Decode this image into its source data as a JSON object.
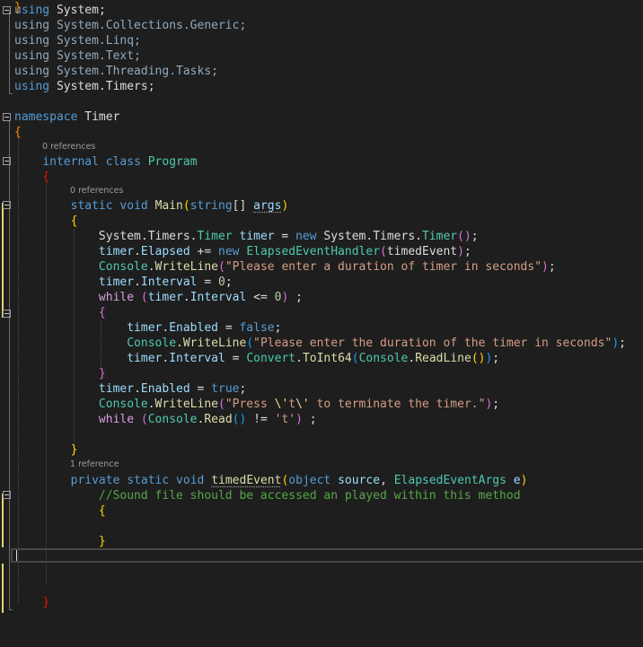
{
  "editor": {
    "codelens": {
      "program_refs": "0 references",
      "main_refs": "0 references",
      "timed_event_refs": "1 reference"
    },
    "lines": [
      {
        "id": "using-system",
        "tokens": [
          [
            "kw",
            "using"
          ],
          [
            "pl",
            " "
          ],
          [
            "pl",
            "System"
          ],
          [
            "pl",
            ";"
          ]
        ]
      },
      {
        "id": "using-collections",
        "tokens": [
          [
            "kw faded",
            "using"
          ],
          [
            "pl faded",
            " System.Collections.Generic;"
          ]
        ]
      },
      {
        "id": "using-linq",
        "tokens": [
          [
            "kw faded",
            "using"
          ],
          [
            "pl faded",
            " System.Linq;"
          ]
        ]
      },
      {
        "id": "using-text",
        "tokens": [
          [
            "kw faded",
            "using"
          ],
          [
            "pl faded",
            " System.Text;"
          ]
        ]
      },
      {
        "id": "using-tasks",
        "tokens": [
          [
            "kw faded",
            "using"
          ],
          [
            "pl faded",
            " System.Threading.Tasks;"
          ]
        ]
      },
      {
        "id": "using-timers",
        "tokens": [
          [
            "kw",
            "using"
          ],
          [
            "pl",
            " System.Timers;"
          ]
        ]
      },
      {
        "id": "blank-1",
        "tokens": []
      },
      {
        "id": "namespace-decl",
        "tokens": [
          [
            "kw",
            "namespace"
          ],
          [
            "pl",
            " Timer"
          ]
        ]
      },
      {
        "id": "ns-open",
        "tokens": [
          [
            "bo",
            "{"
          ]
        ]
      },
      {
        "id": "class-decl",
        "tokens": [
          [
            "pl",
            "    "
          ],
          [
            "kw",
            "internal"
          ],
          [
            "pl",
            " "
          ],
          [
            "kw",
            "class"
          ],
          [
            "pl",
            " "
          ],
          [
            "ty",
            "Program"
          ]
        ]
      },
      {
        "id": "class-open",
        "tokens": [
          [
            "pl",
            "    "
          ],
          [
            "br",
            "{"
          ]
        ]
      },
      {
        "id": "main-decl",
        "tokens": [
          [
            "pl",
            "        "
          ],
          [
            "kw",
            "static"
          ],
          [
            "pl",
            " "
          ],
          [
            "kw",
            "void"
          ],
          [
            "pl",
            " "
          ],
          [
            "fn",
            "Main"
          ],
          [
            "b1",
            "("
          ],
          [
            "kw",
            "string"
          ],
          [
            "pl",
            "[] "
          ],
          [
            "vr sq",
            "args"
          ],
          [
            "b1",
            ")"
          ]
        ]
      },
      {
        "id": "main-open",
        "tokens": [
          [
            "pl",
            "        "
          ],
          [
            "b1",
            "{"
          ]
        ]
      },
      {
        "id": "new-timer",
        "tokens": [
          [
            "pl",
            "            System.Timers."
          ],
          [
            "ty",
            "Timer"
          ],
          [
            "pl",
            " "
          ],
          [
            "vr",
            "timer"
          ],
          [
            "pl",
            " = "
          ],
          [
            "kw",
            "new"
          ],
          [
            "pl",
            " System.Timers."
          ],
          [
            "ty",
            "Timer"
          ],
          [
            "b2",
            "()"
          ],
          [
            "pl",
            ";"
          ]
        ]
      },
      {
        "id": "elapsed-handler",
        "tokens": [
          [
            "pl",
            "            "
          ],
          [
            "vr",
            "timer"
          ],
          [
            "pl",
            "."
          ],
          [
            "vr",
            "Elapsed"
          ],
          [
            "pl",
            " += "
          ],
          [
            "kw",
            "new"
          ],
          [
            "pl",
            " "
          ],
          [
            "ty",
            "ElapsedEventHandler"
          ],
          [
            "b2",
            "("
          ],
          [
            "pl",
            "timedEvent"
          ],
          [
            "b2",
            ")"
          ],
          [
            "pl",
            ";"
          ]
        ]
      },
      {
        "id": "prompt-1",
        "tokens": [
          [
            "pl",
            "            "
          ],
          [
            "ty",
            "Console"
          ],
          [
            "pl",
            "."
          ],
          [
            "fn",
            "WriteLine"
          ],
          [
            "b2",
            "("
          ],
          [
            "st",
            "\"Please enter a duration of timer in seconds\""
          ],
          [
            "b2",
            ")"
          ],
          [
            "pl",
            ";"
          ]
        ]
      },
      {
        "id": "interval-zero",
        "tokens": [
          [
            "pl",
            "            "
          ],
          [
            "vr",
            "timer"
          ],
          [
            "pl",
            "."
          ],
          [
            "vr",
            "Interval"
          ],
          [
            "pl",
            " = "
          ],
          [
            "nu",
            "0"
          ],
          [
            "pl",
            ";"
          ]
        ]
      },
      {
        "id": "while-interval",
        "tokens": [
          [
            "pl",
            "            "
          ],
          [
            "ctl",
            "while"
          ],
          [
            "pl",
            " "
          ],
          [
            "b2",
            "("
          ],
          [
            "vr",
            "timer"
          ],
          [
            "pl",
            "."
          ],
          [
            "vr",
            "Interval"
          ],
          [
            "pl",
            " <= "
          ],
          [
            "nu",
            "0"
          ],
          [
            "b2",
            ")"
          ],
          [
            "pl",
            " ;"
          ]
        ]
      },
      {
        "id": "while-open",
        "tokens": [
          [
            "pl",
            "            "
          ],
          [
            "b2",
            "{"
          ]
        ]
      },
      {
        "id": "enabled-false",
        "tokens": [
          [
            "pl",
            "                "
          ],
          [
            "vr",
            "timer"
          ],
          [
            "pl",
            "."
          ],
          [
            "vr",
            "Enabled"
          ],
          [
            "pl",
            " = "
          ],
          [
            "kw",
            "false"
          ],
          [
            "pl",
            ";"
          ]
        ]
      },
      {
        "id": "prompt-2",
        "tokens": [
          [
            "pl",
            "                "
          ],
          [
            "ty",
            "Console"
          ],
          [
            "pl",
            "."
          ],
          [
            "fn",
            "WriteLine"
          ],
          [
            "b3",
            "("
          ],
          [
            "st",
            "\"Please enter the duration of the timer in seconds\""
          ],
          [
            "b3",
            ")"
          ],
          [
            "pl",
            ";"
          ]
        ]
      },
      {
        "id": "interval-read",
        "tokens": [
          [
            "pl",
            "                "
          ],
          [
            "vr",
            "timer"
          ],
          [
            "pl",
            "."
          ],
          [
            "vr",
            "Interval"
          ],
          [
            "pl",
            " = "
          ],
          [
            "ty",
            "Convert"
          ],
          [
            "pl",
            "."
          ],
          [
            "fn",
            "ToInt64"
          ],
          [
            "b3",
            "("
          ],
          [
            "ty",
            "Console"
          ],
          [
            "pl",
            "."
          ],
          [
            "fn",
            "ReadLine"
          ],
          [
            "b1",
            "()"
          ],
          [
            "b3",
            ")"
          ],
          [
            "pl",
            ";"
          ]
        ]
      },
      {
        "id": "while-close",
        "tokens": [
          [
            "pl",
            "            "
          ],
          [
            "b2",
            "}"
          ]
        ]
      },
      {
        "id": "enabled-true",
        "tokens": [
          [
            "pl",
            "            "
          ],
          [
            "vr",
            "timer"
          ],
          [
            "pl",
            "."
          ],
          [
            "vr",
            "Enabled"
          ],
          [
            "pl",
            " = "
          ],
          [
            "kw",
            "true"
          ],
          [
            "pl",
            ";"
          ]
        ]
      },
      {
        "id": "prompt-3",
        "tokens": [
          [
            "pl",
            "            "
          ],
          [
            "ty",
            "Console"
          ],
          [
            "pl",
            "."
          ],
          [
            "fn",
            "WriteLine"
          ],
          [
            "b2",
            "("
          ],
          [
            "st",
            "\"Press "
          ],
          [
            "es",
            "\\'"
          ],
          [
            "st",
            "t"
          ],
          [
            "es",
            "\\'"
          ],
          [
            "st",
            " to terminate the timer.\""
          ],
          [
            "b2",
            ")"
          ],
          [
            "pl",
            ";"
          ]
        ]
      },
      {
        "id": "while-read",
        "tokens": [
          [
            "pl",
            "            "
          ],
          [
            "ctl",
            "while"
          ],
          [
            "pl",
            " "
          ],
          [
            "b2",
            "("
          ],
          [
            "ty",
            "Console"
          ],
          [
            "pl",
            "."
          ],
          [
            "fn",
            "Read"
          ],
          [
            "b3",
            "()"
          ],
          [
            "pl",
            " != "
          ],
          [
            "st",
            "'t'"
          ],
          [
            "b2",
            ")"
          ],
          [
            "pl",
            " ;"
          ]
        ]
      },
      {
        "id": "blank-2",
        "tokens": []
      },
      {
        "id": "main-close",
        "tokens": [
          [
            "pl",
            "        "
          ],
          [
            "b1",
            "}"
          ]
        ]
      },
      {
        "id": "timed-event-decl",
        "tokens": [
          [
            "pl",
            "        "
          ],
          [
            "kw",
            "private"
          ],
          [
            "pl",
            " "
          ],
          [
            "kw",
            "static"
          ],
          [
            "pl",
            " "
          ],
          [
            "kw",
            "void"
          ],
          [
            "pl",
            " "
          ],
          [
            "fn sq",
            "timedEvent"
          ],
          [
            "b1",
            "("
          ],
          [
            "kw",
            "object"
          ],
          [
            "pl",
            " "
          ],
          [
            "vr",
            "source"
          ],
          [
            "pl",
            ", "
          ],
          [
            "ty",
            "ElapsedEventArgs"
          ],
          [
            "pl",
            " "
          ],
          [
            "vr",
            "e"
          ],
          [
            "b1",
            ")"
          ]
        ]
      },
      {
        "id": "comment",
        "tokens": [
          [
            "pl",
            "            "
          ],
          [
            "cm",
            "//Sound file should be accessed an played within this method"
          ]
        ]
      },
      {
        "id": "timed-event-open",
        "tokens": [
          [
            "pl",
            "            "
          ],
          [
            "b1",
            "{"
          ]
        ]
      },
      {
        "id": "blank-3",
        "tokens": []
      },
      {
        "id": "timed-event-close",
        "tokens": [
          [
            "pl",
            "            "
          ],
          [
            "b1",
            "}"
          ]
        ]
      },
      {
        "id": "current-line",
        "tokens": []
      },
      {
        "id": "blank-4",
        "tokens": []
      },
      {
        "id": "blank-5",
        "tokens": []
      },
      {
        "id": "class-close",
        "tokens": [
          [
            "pl",
            "    "
          ],
          [
            "br",
            "}"
          ]
        ]
      },
      {
        "id": "ns-close",
        "tokens": [
          [
            "bo",
            "}"
          ]
        ]
      }
    ]
  }
}
